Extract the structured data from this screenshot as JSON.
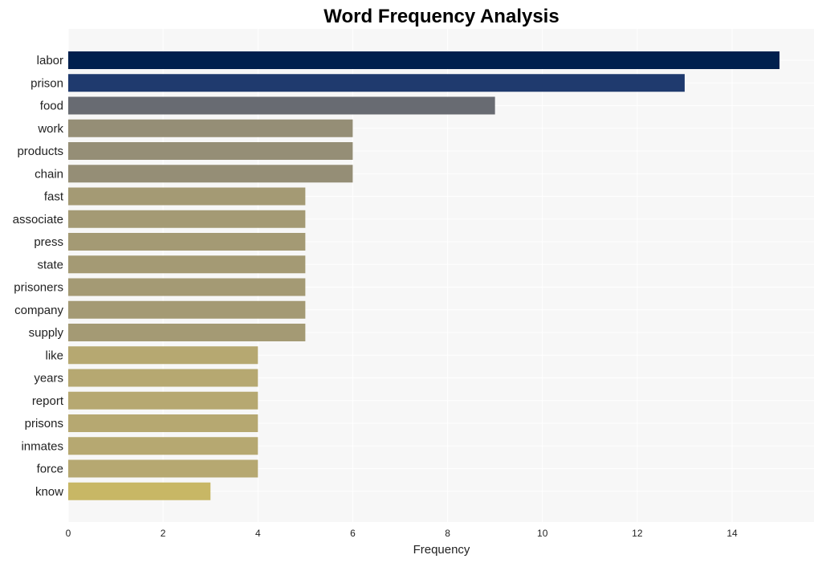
{
  "chart_data": {
    "type": "bar",
    "orientation": "horizontal",
    "title": "Word Frequency Analysis",
    "xlabel": "Frequency",
    "ylabel": "",
    "xlim": [
      0,
      15.7
    ],
    "xticks": [
      0,
      2,
      4,
      6,
      8,
      10,
      12,
      14
    ],
    "grid": true,
    "legend": "none",
    "categories": [
      "labor",
      "prison",
      "food",
      "work",
      "products",
      "chain",
      "fast",
      "associate",
      "press",
      "state",
      "prisoners",
      "company",
      "supply",
      "like",
      "years",
      "report",
      "prisons",
      "inmates",
      "force",
      "know"
    ],
    "values": [
      15,
      13,
      9,
      6,
      6,
      6,
      5,
      5,
      5,
      5,
      5,
      5,
      5,
      4,
      4,
      4,
      4,
      4,
      4,
      3
    ],
    "colors": [
      "#00204e",
      "#1f3a6e",
      "#686b72",
      "#958e76",
      "#958e76",
      "#958e76",
      "#a49a74",
      "#a49a74",
      "#a49a74",
      "#a49a74",
      "#a49a74",
      "#a49a74",
      "#a49a74",
      "#b6a871",
      "#b6a871",
      "#b6a871",
      "#b6a871",
      "#b6a871",
      "#b6a871",
      "#c8b765"
    ]
  },
  "style": {
    "plot_background": "#f7f7f7",
    "grid_color": "#ffffff"
  }
}
